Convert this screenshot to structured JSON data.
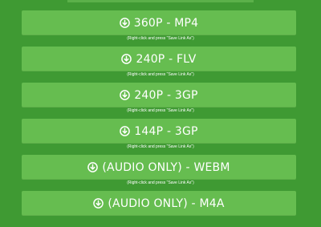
{
  "downloads": [
    {
      "label": "360P - MP4",
      "hint": "(Right-click and press \"Save Link As\")",
      "icon": "download-circle-icon"
    },
    {
      "label": "240P - FLV",
      "hint": "(Right-click and press \"Save Link As\")",
      "icon": "download-circle-icon"
    },
    {
      "label": "240P - 3GP",
      "hint": "(Right-click and press \"Save Link As\")",
      "icon": "download-circle-icon"
    },
    {
      "label": "144P - 3GP",
      "hint": "(Right-click and press \"Save Link As\")",
      "icon": "download-circle-icon"
    },
    {
      "label": "(AUDIO ONLY) - WEBM",
      "hint": "(Right-click and press \"Save Link As\")",
      "icon": "download-circle-icon"
    },
    {
      "label": "(AUDIO ONLY) - M4A",
      "hint": "",
      "icon": "download-circle-icon"
    }
  ],
  "colors": {
    "background": "#3f9a33",
    "button": "#66bd50",
    "text": "#ffffff"
  }
}
